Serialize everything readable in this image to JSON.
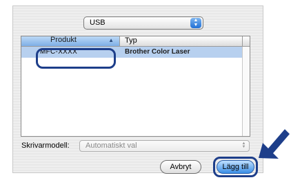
{
  "connection": {
    "value": "USB"
  },
  "table": {
    "columns": {
      "product": "Produkt",
      "type": "Typ"
    },
    "rows": [
      {
        "product": "MFC-XXXX",
        "type": "Brother Color Laser"
      }
    ]
  },
  "model": {
    "label": "Skrivarmodell:",
    "value": "Automatiskt val"
  },
  "buttons": {
    "cancel": "Avbryt",
    "add": "Lägg till"
  },
  "colors": {
    "highlight": "#1d3e8a",
    "selection": "#b7d0ef"
  }
}
